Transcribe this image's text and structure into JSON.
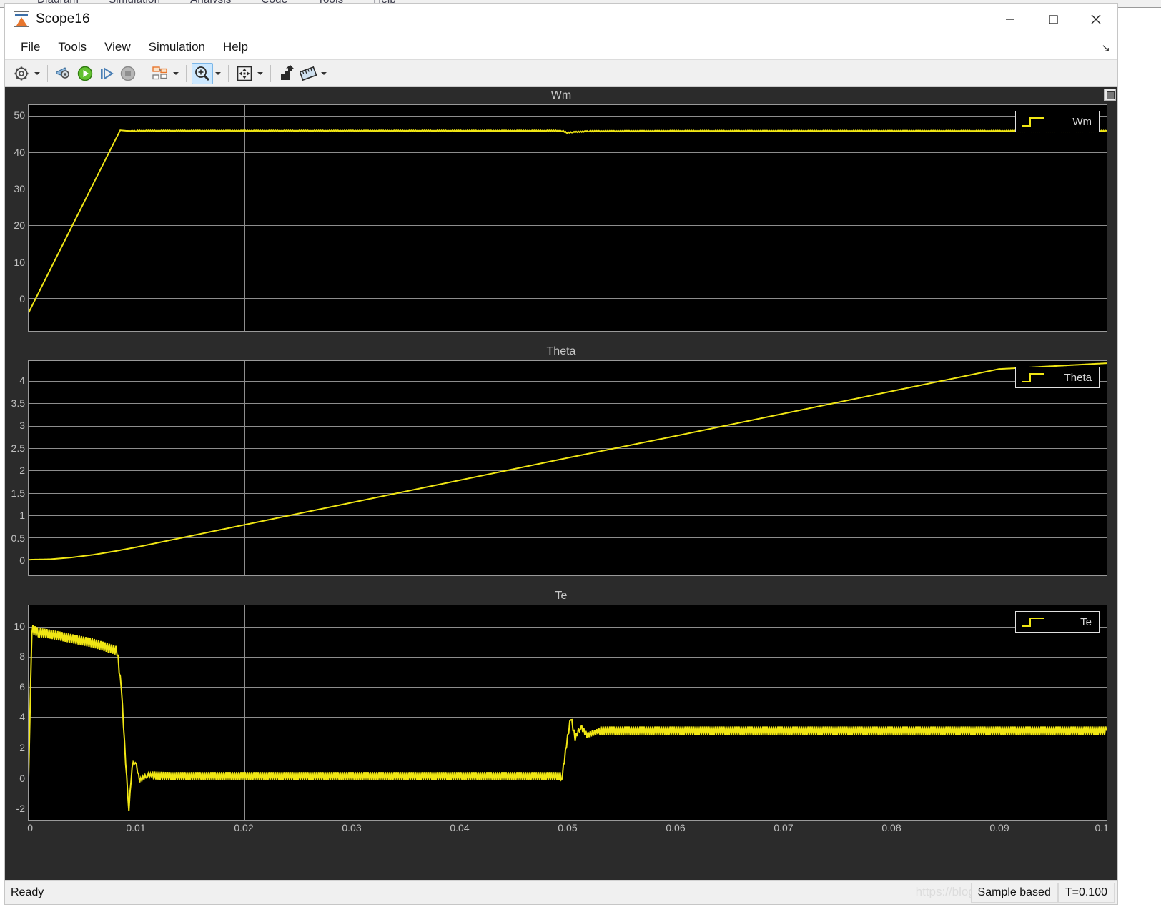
{
  "background_window": {
    "menus": [
      "Diagram",
      "Simulation",
      "Analysis",
      "Code",
      "Tools",
      "Help"
    ]
  },
  "window": {
    "title": "Scope16",
    "icon": "matlab-scope-icon",
    "minimize_label": "—",
    "maximize_label": "☐",
    "close_label": "✕"
  },
  "menubar": {
    "items": [
      {
        "label": "File",
        "name": "menu-file"
      },
      {
        "label": "Tools",
        "name": "menu-tools"
      },
      {
        "label": "View",
        "name": "menu-view"
      },
      {
        "label": "Simulation",
        "name": "menu-simulation"
      },
      {
        "label": "Help",
        "name": "menu-help"
      }
    ],
    "collapse_glyph": "↘"
  },
  "toolbar": {
    "buttons": [
      {
        "name": "configuration-properties-icon",
        "label": "Configuration Properties",
        "dropdown": true,
        "active": false
      },
      {
        "name": "simulink-model-icon",
        "label": "Simulink Model",
        "dropdown": false,
        "active": false
      },
      {
        "name": "run-icon",
        "label": "Run",
        "dropdown": false,
        "active": false
      },
      {
        "name": "step-forward-icon",
        "label": "Step Forward",
        "dropdown": false,
        "active": false
      },
      {
        "name": "stop-icon",
        "label": "Stop",
        "dropdown": false,
        "active": false
      },
      {
        "name": "layout-icon",
        "label": "Layout",
        "dropdown": true,
        "active": false
      },
      {
        "name": "zoom-in-icon",
        "label": "Zoom In",
        "dropdown": true,
        "active": true
      },
      {
        "name": "pan-icon",
        "label": "Pan",
        "dropdown": true,
        "active": false
      },
      {
        "name": "autoscale-icon",
        "label": "Autoscale",
        "dropdown": false,
        "active": false
      },
      {
        "name": "cursor-measurements-icon",
        "label": "Cursor Measurements",
        "dropdown": true,
        "active": false
      }
    ]
  },
  "statusbar": {
    "ready": "Ready",
    "sample_mode": "Sample based",
    "time": "T=0.100",
    "watermark": "https://blog.csdn.net/mr_no_deep"
  },
  "chart_data": [
    {
      "type": "line",
      "name": "wm-plot",
      "title": "Wm",
      "legend": [
        "Wm"
      ],
      "legend_position": "top-right",
      "xlabel": "",
      "ylabel": "",
      "xlim": [
        0,
        0.1
      ],
      "ylim": [
        -5,
        57
      ],
      "xticks": [
        0,
        0.01,
        0.02,
        0.03,
        0.04,
        0.05,
        0.06,
        0.07,
        0.08,
        0.09,
        0.1
      ],
      "yticks": [
        0,
        10,
        20,
        30,
        40,
        50
      ],
      "ytick_labels": [
        "0",
        "10",
        "20",
        "30",
        "40",
        "50"
      ],
      "grid": true,
      "line_color": "#f0e614",
      "x": [
        0,
        0.001,
        0.002,
        0.003,
        0.004,
        0.005,
        0.006,
        0.007,
        0.008,
        0.0085,
        0.009,
        0.0095,
        0.01,
        0.02,
        0.03,
        0.04,
        0.0495,
        0.05,
        0.0505,
        0.052,
        0.06,
        0.07,
        0.08,
        0.09,
        0.1
      ],
      "y": [
        0,
        5.9,
        11.8,
        17.7,
        23.6,
        29.5,
        35.4,
        41.3,
        47.2,
        50.1,
        49.95,
        49.9,
        49.95,
        49.95,
        49.95,
        49.95,
        49.95,
        49.4,
        49.6,
        49.85,
        49.9,
        49.9,
        49.9,
        49.9,
        49.9
      ]
    },
    {
      "type": "line",
      "name": "theta-plot",
      "title": "Theta",
      "legend": [
        "Theta"
      ],
      "legend_position": "top-right",
      "xlabel": "",
      "ylabel": "",
      "xlim": [
        0,
        0.1
      ],
      "ylim": [
        -0.35,
        4.45
      ],
      "xticks": [
        0,
        0.01,
        0.02,
        0.03,
        0.04,
        0.05,
        0.06,
        0.07,
        0.08,
        0.09,
        0.1
      ],
      "yticks": [
        0,
        0.5,
        1,
        1.5,
        2,
        2.5,
        3,
        3.5,
        4
      ],
      "ytick_labels": [
        "0",
        "0.5",
        "1",
        "1.5",
        "2",
        "2.5",
        "3",
        "3.5",
        "4"
      ],
      "grid": true,
      "line_color": "#f0e614",
      "x": [
        0,
        0.002,
        0.004,
        0.006,
        0.008,
        0.01,
        0.02,
        0.03,
        0.04,
        0.05,
        0.06,
        0.07,
        0.08,
        0.09,
        0.1
      ],
      "y": [
        0,
        0.01,
        0.05,
        0.11,
        0.19,
        0.28,
        0.78,
        1.28,
        1.78,
        2.28,
        2.77,
        3.27,
        3.77,
        4.27,
        4.4
      ]
    },
    {
      "type": "line",
      "name": "te-plot",
      "title": "Te",
      "legend": [
        "Te"
      ],
      "legend_position": "top-right",
      "xlabel": "",
      "ylabel": "",
      "xlim": [
        0,
        0.1
      ],
      "ylim": [
        -2.8,
        11.4
      ],
      "xticks": [
        0,
        0.01,
        0.02,
        0.03,
        0.04,
        0.05,
        0.06,
        0.07,
        0.08,
        0.09,
        0.1
      ],
      "xtick_labels": [
        "0",
        "0.01",
        "0.02",
        "0.03",
        "0.04",
        "0.05",
        "0.06",
        "0.07",
        "0.08",
        "0.09",
        "0.1"
      ],
      "yticks": [
        -2,
        0,
        2,
        4,
        6,
        8,
        10
      ],
      "ytick_labels": [
        "-2",
        "0",
        "2",
        "4",
        "6",
        "8",
        "10"
      ],
      "grid": true,
      "line_color": "#f0e614",
      "x": [
        0,
        0.0003,
        0.001,
        0.002,
        0.004,
        0.006,
        0.0082,
        0.0086,
        0.009,
        0.0093,
        0.0096,
        0.0099,
        0.0103,
        0.011,
        0.013,
        0.02,
        0.03,
        0.04,
        0.0495,
        0.0499,
        0.0503,
        0.0507,
        0.0512,
        0.0518,
        0.053,
        0.06,
        0.07,
        0.08,
        0.09,
        0.1
      ],
      "y": [
        0,
        9.8,
        9.6,
        9.5,
        9.2,
        8.9,
        8.4,
        6.0,
        1.0,
        -2.1,
        0.8,
        1.1,
        -0.2,
        0.15,
        0.1,
        0.1,
        0.1,
        0.1,
        0.1,
        2.2,
        4.0,
        2.6,
        3.4,
        2.8,
        3.1,
        3.1,
        3.1,
        3.1,
        3.1,
        3.1
      ]
    }
  ]
}
